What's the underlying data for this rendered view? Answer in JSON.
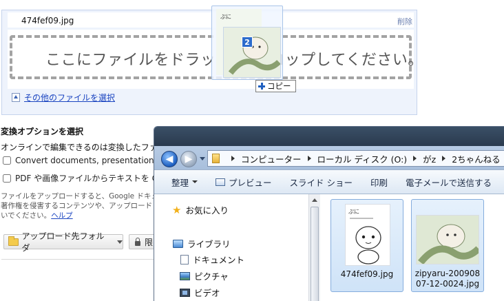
{
  "upload": {
    "file_name": "474fef09.jpg",
    "delete_label": "削除",
    "drop_text": "ここにファイルをドラッグ & ドロップしてください。",
    "other_files_link": "その他のファイルを選択"
  },
  "convert": {
    "title": "変換オプションを選択",
    "description": "オンラインで編集できるのは変換したファ",
    "option_convert": "Convert documents, presentations,",
    "option_ocr": "PDF や画像ファイルからテキストを G",
    "option_convert_checked": false,
    "option_ocr_checked": false,
    "legal_line1": "ファイルをアップロードすると、Google ドキュ",
    "legal_line2": "著作権を侵害するコンテンツや、アップロード",
    "legal_line3": "いでください。",
    "help_link": "ヘルプ",
    "folder_button": "アップロード先フォルダ",
    "share_button": "限"
  },
  "drag": {
    "count": "2",
    "copy_tooltip": "コピー"
  },
  "explorer": {
    "breadcrumb": [
      "コンピューター",
      "ローカル ディスク (O:)",
      "がz",
      "2ちゃんねる"
    ],
    "toolbar": {
      "organize": "整理",
      "preview": "プレビュー",
      "slideshow": "スライド ショー",
      "print": "印刷",
      "email": "電子メールで送信する"
    },
    "nav": {
      "favorites": "お気に入り",
      "libraries": "ライブラリ",
      "documents": "ドキュメント",
      "pictures": "ピクチャ",
      "videos": "ビデオ"
    },
    "files": [
      {
        "name_line1": "474fef09.jpg",
        "name_line2": ""
      },
      {
        "name_line1": "zipyaru-200908",
        "name_line2": "07-12-0024.jpg"
      }
    ]
  },
  "colors": {
    "link": "#1a44c0",
    "panel_bg": "#eef3fc",
    "selection_tile": "#cfe3f8",
    "address_bg": "#f7fafe"
  }
}
